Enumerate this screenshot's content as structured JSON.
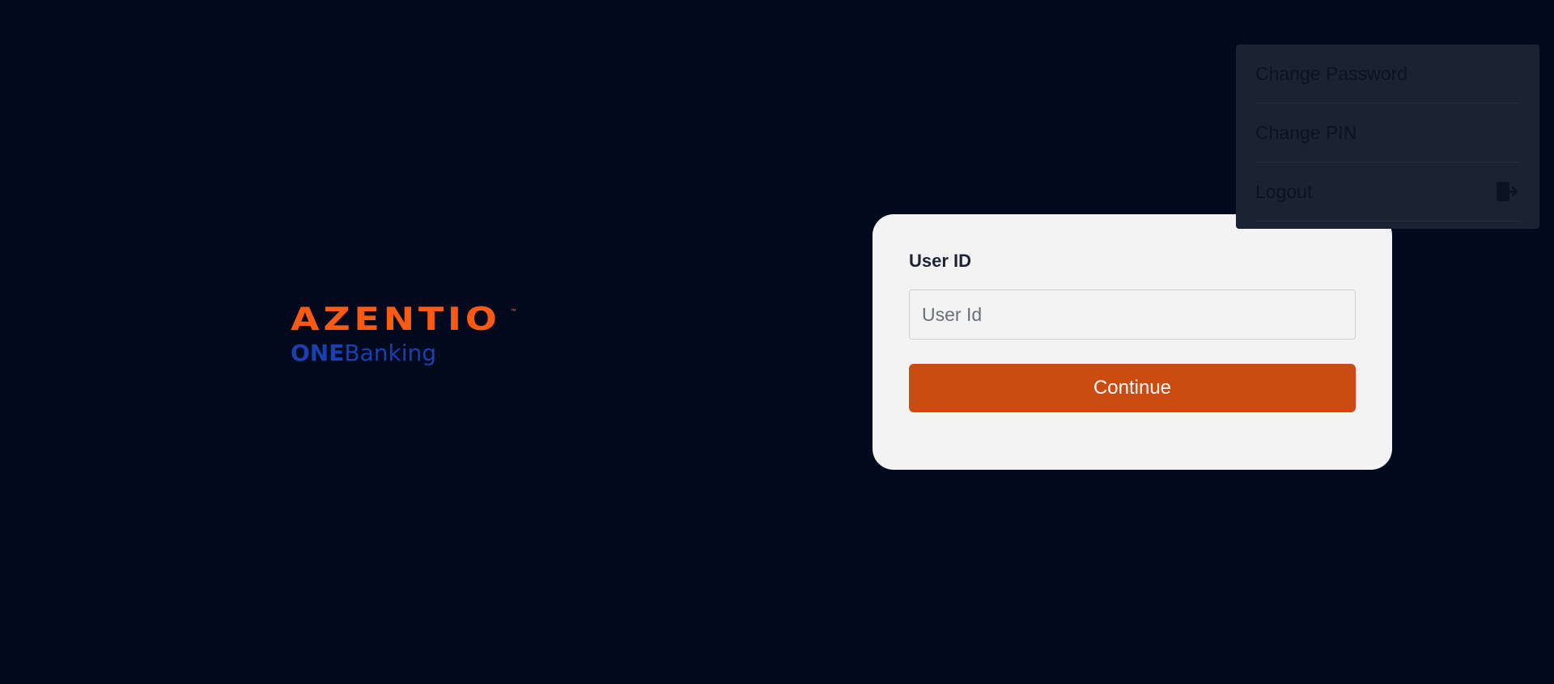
{
  "logo": {
    "brand": "AZENTIO",
    "trademark": "™",
    "sub_strong": "ONE",
    "sub_light": "Banking"
  },
  "login": {
    "label": "User ID",
    "placeholder": "User Id",
    "value": "",
    "continue_label": "Continue"
  },
  "menu": {
    "items": [
      {
        "label": "Change Password"
      },
      {
        "label": "Change PIN"
      },
      {
        "label": "Logout",
        "icon": "logout-icon"
      }
    ]
  },
  "colors": {
    "background": "#000a1c",
    "brand_orange": "#ff5a14",
    "button": "#cb4b10",
    "sub_blue": "#1c3fb0",
    "menu_bg": "#1b2333",
    "card_bg": "#f3f3f3"
  }
}
